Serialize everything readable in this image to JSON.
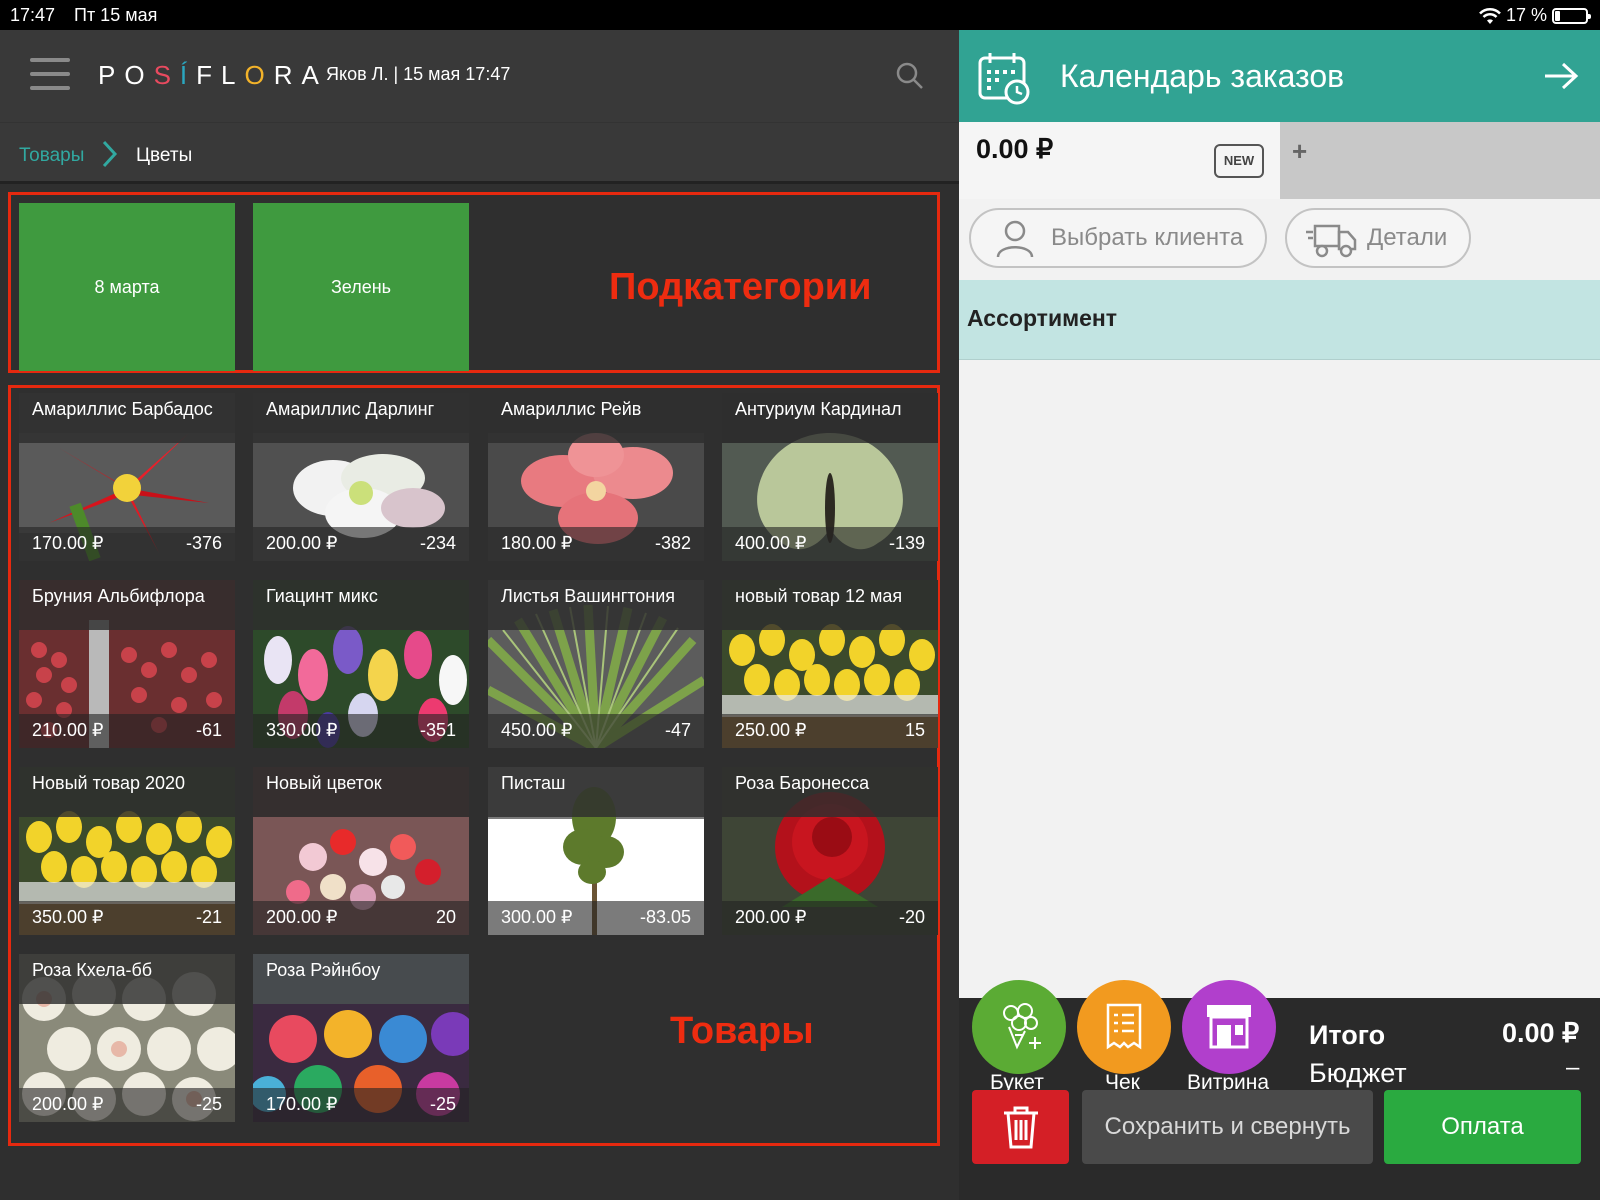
{
  "statusbar": {
    "time": "17:47",
    "date": "Пт 15 мая",
    "battery": "17 %"
  },
  "header": {
    "logo": [
      "P",
      "O",
      "S",
      "Í",
      "F",
      "L",
      "O",
      "R",
      "A"
    ],
    "user": "Яков Л.",
    "datetime": "15 мая 17:47",
    "user_info": "Яков Л.  | 15 мая 17:47"
  },
  "breadcrumbs": {
    "root": "Товары",
    "current": "Цветы"
  },
  "annotations": {
    "subcategories": "Подкатегории",
    "products": "Товары"
  },
  "subcategories": [
    {
      "label": "8 марта",
      "color": "#3f9a3f"
    },
    {
      "label": "Зелень",
      "color": "#3f9a3f"
    }
  ],
  "products": [
    {
      "name": "Амариллис Барбадос",
      "price": "170.00 ₽",
      "stock": "-376",
      "image": "red-amaryllis"
    },
    {
      "name": "Амариллис Дарлинг",
      "price": "200.00 ₽",
      "stock": "-234",
      "image": "white-amaryllis"
    },
    {
      "name": "Амариллис Рейв",
      "price": "180.00 ₽",
      "stock": "-382",
      "image": "pink-amaryllis"
    },
    {
      "name": "Антуриум Кардинал",
      "price": "400.00 ₽",
      "stock": "-139",
      "image": "anthurium"
    },
    {
      "name": "Бруния Альбифлора",
      "price": "210.00 ₽",
      "stock": "-61",
      "image": "brunia-berries"
    },
    {
      "name": "Гиацинт микс",
      "price": "330.00 ₽",
      "stock": "-351",
      "image": "hyacinth-mix"
    },
    {
      "name": "Листья Вашингтония",
      "price": "450.00 ₽",
      "stock": "-47",
      "image": "palm-leaf"
    },
    {
      "name": "новый товар 12 мая",
      "price": "250.00 ₽",
      "stock": "15",
      "image": "yellow-tulips"
    },
    {
      "name": "Новый товар 2020",
      "price": "350.00 ₽",
      "stock": "-21",
      "image": "yellow-tulips"
    },
    {
      "name": "Новый цветок",
      "price": "200.00 ₽",
      "stock": "20",
      "image": "mixed-bouquet"
    },
    {
      "name": "Писташ",
      "price": "300.00 ₽",
      "stock": "-83.05",
      "image": "pistache-branch"
    },
    {
      "name": "Роза Баронесса",
      "price": "200.00 ₽",
      "stock": "-20",
      "image": "red-rose"
    },
    {
      "name": "Роза Кхела-бб",
      "price": "200.00 ₽",
      "stock": "-25",
      "image": "cream-roses"
    },
    {
      "name": "Роза Рэйнбоу",
      "price": "170.00 ₽",
      "stock": "-25",
      "image": "rainbow-roses"
    }
  ],
  "order": {
    "title": "Календарь заказов",
    "total": "0.00 ₽",
    "new_badge": "NEW",
    "add_tab": "+",
    "choose_client": "Выбрать клиента",
    "details": "Детали",
    "assortment": "Ассортимент",
    "actions": [
      {
        "label": "Букет",
        "color": "#5bab34",
        "icon": "bouquet-icon"
      },
      {
        "label": "Чек",
        "color": "#f29a1f",
        "icon": "receipt-icon"
      },
      {
        "label": "Витрина",
        "color": "#b13fcc",
        "icon": "storefront-icon"
      }
    ],
    "total_label": "Итого",
    "total_value": "0.00 ₽",
    "budget_label": "Бюджет",
    "budget_value": "–",
    "save_label": "Сохранить и свернуть",
    "pay_label": "Оплата"
  },
  "colors": {
    "accent_teal": "#31a393",
    "assortment_bg": "#c2e4e2",
    "pay_green": "#2aaa40",
    "delete_red": "#d41f26",
    "annotation_red": "#e6290f"
  }
}
